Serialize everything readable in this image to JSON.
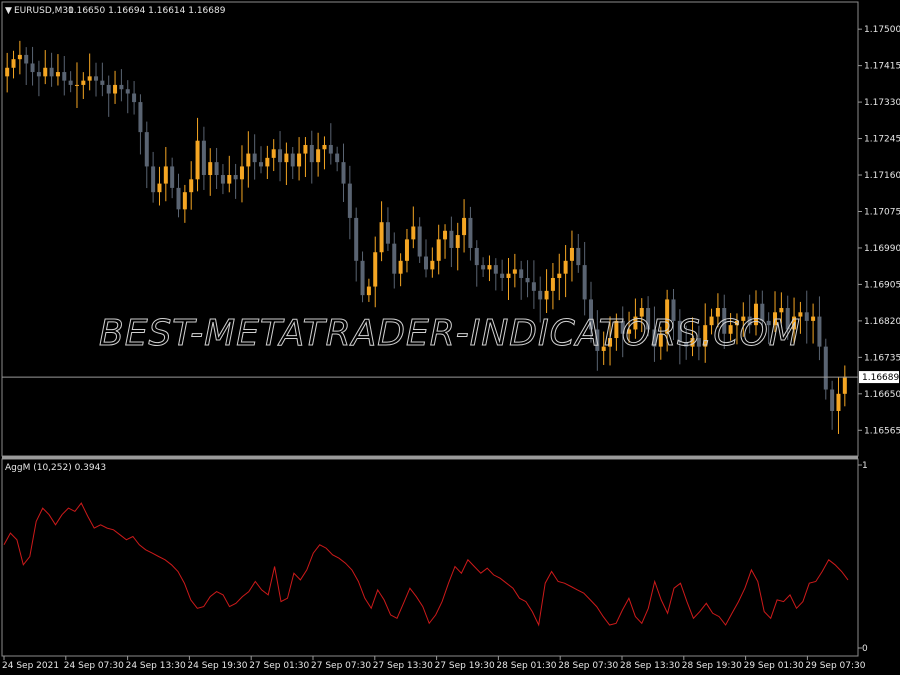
{
  "chart_data": [
    {
      "type": "candlestick",
      "symbol_header": "EURUSD,M30",
      "ohlc_header": "1.16650 1.16694 1.16614 1.16689",
      "current_price_label": "1.16689",
      "current_price": 1.16689,
      "ylim": [
        1.1654,
        1.1754
      ],
      "y_ticks": [
        "1.17500",
        "1.17415",
        "1.17330",
        "1.17245",
        "1.17160",
        "1.17075",
        "1.16990",
        "1.16905",
        "1.16820",
        "1.16735",
        "1.16650",
        "1.16565"
      ],
      "x_ticks": [
        "24 Sep 2021",
        "24 Sep 07:30",
        "24 Sep 13:30",
        "24 Sep 19:30",
        "27 Sep 01:30",
        "27 Sep 07:30",
        "27 Sep 13:30",
        "27 Sep 19:30",
        "28 Sep 01:30",
        "28 Sep 07:30",
        "28 Sep 13:30",
        "28 Sep 19:30",
        "29 Sep 01:30",
        "29 Sep 07:30"
      ],
      "bull_color": "#f5a623",
      "bear_color": "#5a6472",
      "close_series": [
        1.1741,
        1.1743,
        1.1744,
        1.1742,
        1.174,
        1.1739,
        1.1741,
        1.1739,
        1.174,
        1.1738,
        1.1737,
        1.1737,
        1.1738,
        1.1739,
        1.1738,
        1.1737,
        1.1735,
        1.1737,
        1.1736,
        1.1735,
        1.1733,
        1.1726,
        1.1718,
        1.1712,
        1.1714,
        1.1718,
        1.1713,
        1.1708,
        1.1712,
        1.1715,
        1.1724,
        1.1716,
        1.1719,
        1.1716,
        1.1714,
        1.1716,
        1.1715,
        1.1718,
        1.1721,
        1.1719,
        1.1718,
        1.172,
        1.1722,
        1.1719,
        1.1721,
        1.1718,
        1.1721,
        1.1723,
        1.1719,
        1.1722,
        1.1723,
        1.1721,
        1.1719,
        1.1714,
        1.1706,
        1.1696,
        1.1688,
        1.169,
        1.1698,
        1.1705,
        1.17,
        1.1693,
        1.1696,
        1.1701,
        1.1704,
        1.1697,
        1.1694,
        1.1696,
        1.1701,
        1.1703,
        1.1699,
        1.1702,
        1.1706,
        1.1699,
        1.1695,
        1.1694,
        1.1695,
        1.1693,
        1.1692,
        1.1693,
        1.1694,
        1.1692,
        1.1691,
        1.1689,
        1.1687,
        1.1689,
        1.1692,
        1.1693,
        1.1696,
        1.1699,
        1.1695,
        1.1687,
        1.168,
        1.1675,
        1.1676,
        1.1678,
        1.1682,
        1.1679,
        1.168,
        1.1683,
        1.1685,
        1.168,
        1.1676,
        1.1679,
        1.1687,
        1.1682,
        1.1677,
        1.1676,
        1.1678,
        1.1676,
        1.1681,
        1.1683,
        1.1685,
        1.1679,
        1.1681,
        1.1682,
        1.1683,
        1.1681,
        1.1686,
        1.1682,
        1.1681,
        1.1684,
        1.1685,
        1.168,
        1.1683,
        1.1684,
        1.1682,
        1.1683,
        1.1676,
        1.1666,
        1.1661,
        1.1665,
        1.1669
      ]
    },
    {
      "type": "line",
      "indicator_label": "AggM (10,252) 0.3943",
      "y_ticks": [
        "1",
        "0"
      ],
      "ylim": [
        0,
        1
      ],
      "line_color": "#cc1a1a",
      "values": [
        0.6,
        0.67,
        0.63,
        0.48,
        0.53,
        0.74,
        0.82,
        0.78,
        0.72,
        0.78,
        0.82,
        0.8,
        0.85,
        0.77,
        0.7,
        0.72,
        0.7,
        0.69,
        0.66,
        0.63,
        0.65,
        0.6,
        0.57,
        0.55,
        0.53,
        0.51,
        0.48,
        0.44,
        0.37,
        0.27,
        0.22,
        0.23,
        0.29,
        0.32,
        0.3,
        0.23,
        0.25,
        0.29,
        0.32,
        0.38,
        0.33,
        0.3,
        0.47,
        0.26,
        0.28,
        0.43,
        0.39,
        0.45,
        0.55,
        0.6,
        0.58,
        0.54,
        0.52,
        0.49,
        0.45,
        0.38,
        0.28,
        0.22,
        0.33,
        0.27,
        0.18,
        0.16,
        0.25,
        0.34,
        0.29,
        0.23,
        0.13,
        0.18,
        0.26,
        0.37,
        0.47,
        0.43,
        0.51,
        0.47,
        0.43,
        0.46,
        0.42,
        0.4,
        0.37,
        0.34,
        0.28,
        0.26,
        0.2,
        0.12,
        0.37,
        0.44,
        0.38,
        0.37,
        0.35,
        0.33,
        0.31,
        0.27,
        0.23,
        0.17,
        0.12,
        0.13,
        0.21,
        0.28,
        0.17,
        0.13,
        0.22,
        0.38,
        0.27,
        0.19,
        0.34,
        0.37,
        0.26,
        0.16,
        0.2,
        0.25,
        0.19,
        0.17,
        0.12,
        0.19,
        0.26,
        0.34,
        0.45,
        0.38,
        0.2,
        0.16,
        0.27,
        0.26,
        0.3,
        0.22,
        0.26,
        0.37,
        0.38,
        0.44,
        0.51,
        0.48,
        0.44,
        0.39
      ]
    }
  ],
  "watermark": "BEST-METATRADER-INDICATORS.COM"
}
